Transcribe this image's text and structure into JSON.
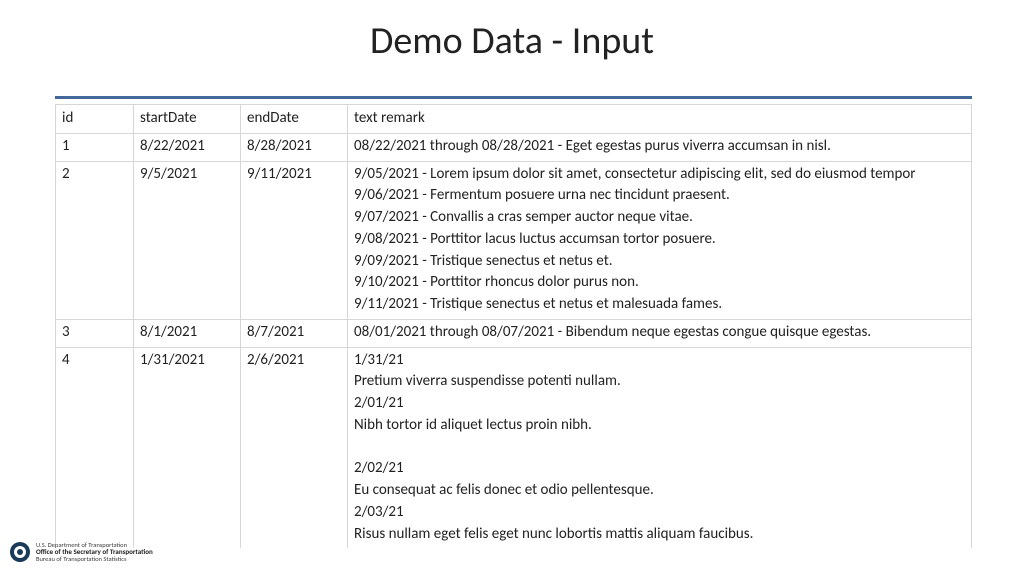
{
  "title": "Demo Data - Input",
  "headers": {
    "id": "id",
    "start": "startDate",
    "end": "endDate",
    "text": "text remark"
  },
  "rows": [
    {
      "id": "1",
      "start": "8/22/2021",
      "end": "8/28/2021",
      "remarks": [
        "08/22/2021 through 08/28/2021 - Eget egestas purus viverra accumsan in nisl."
      ]
    },
    {
      "id": "2",
      "start": "9/5/2021",
      "end": "9/11/2021",
      "remarks": [
        "9/05/2021 - Lorem ipsum dolor sit amet, consectetur adipiscing elit, sed do eiusmod tempor",
        "9/06/2021 - Fermentum posuere urna nec tincidunt praesent.",
        "9/07/2021 - Convallis a cras semper auctor neque vitae.",
        "9/08/2021 - Porttitor lacus luctus accumsan tortor posuere.",
        "9/09/2021 - Tristique senectus et netus et.",
        "9/10/2021 - Porttitor rhoncus dolor purus non.",
        "9/11/2021 - Tristique senectus et netus et malesuada fames."
      ]
    },
    {
      "id": "3",
      "start": "8/1/2021",
      "end": "8/7/2021",
      "remarks": [
        "08/01/2021 through 08/07/2021 - Bibendum neque egestas congue quisque egestas."
      ]
    },
    {
      "id": "4",
      "start": "1/31/2021",
      "end": "2/6/2021",
      "remarks": [
        "1/31/21",
        "Pretium viverra suspendisse potenti nullam.",
        "2/01/21",
        "Nibh tortor id aliquet lectus proin nibh.",
        " ",
        "2/02/21",
        "Eu consequat ac felis donec et odio pellentesque.",
        "2/03/21",
        "Risus nullam eget felis eget nunc lobortis mattis aliquam faucibus."
      ]
    }
  ],
  "footer": {
    "line1": "U.S. Department of Transportation",
    "line2": "Office of the Secretary of Transportation",
    "line3": "Bureau of Transportation Statistics"
  }
}
